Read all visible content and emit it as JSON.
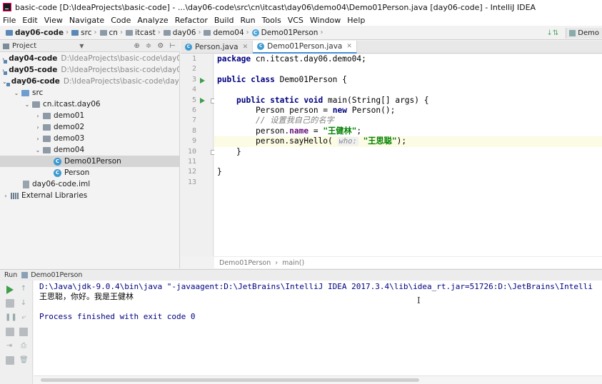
{
  "window": {
    "title": "basic-code [D:\\IdeaProjects\\basic-code] - ...\\day06-code\\src\\cn\\itcast\\day06\\demo04\\Demo01Person.java [day06-code] - IntelliJ IDEA"
  },
  "menu": [
    "File",
    "Edit",
    "View",
    "Navigate",
    "Code",
    "Analyze",
    "Refactor",
    "Build",
    "Run",
    "Tools",
    "VCS",
    "Window",
    "Help"
  ],
  "breadcrumb": [
    "day06-code",
    "src",
    "cn",
    "itcast",
    "day06",
    "demo04",
    "Demo01Person"
  ],
  "toolbar_right": {
    "run_config": "Demo"
  },
  "project_panel": {
    "title": "Project",
    "tree": [
      {
        "label": "day04-code",
        "path": "D:\\IdeaProjects\\basic-code\\day04-code",
        "arrow": "›"
      },
      {
        "label": "day05-code",
        "path": "D:\\IdeaProjects\\basic-code\\day05-code",
        "arrow": "›"
      },
      {
        "label": "day06-code",
        "path": "D:\\IdeaProjects\\basic-code\\day06-code",
        "arrow": "⌄"
      },
      {
        "label": "src",
        "arrow": "⌄"
      },
      {
        "label": "cn.itcast.day06",
        "arrow": "⌄"
      },
      {
        "label": "demo01",
        "arrow": "›"
      },
      {
        "label": "demo02",
        "arrow": "›"
      },
      {
        "label": "demo03",
        "arrow": "›"
      },
      {
        "label": "demo04",
        "arrow": "⌄"
      },
      {
        "label": "Demo01Person"
      },
      {
        "label": "Person"
      },
      {
        "label": "day06-code.iml"
      },
      {
        "label": "External Libraries",
        "arrow": "›"
      }
    ]
  },
  "tabs": [
    {
      "label": "Person.java"
    },
    {
      "label": "Demo01Person.java"
    }
  ],
  "editor": {
    "line_numbers": [
      "1",
      "2",
      "3",
      "4",
      "5",
      "6",
      "7",
      "8",
      "9",
      "10",
      "11",
      "12",
      "13"
    ],
    "code": {
      "l1_kw": "package",
      "l1_rest": " cn.itcast.day06.demo04;",
      "l3_kw1": "public",
      "l3_kw2": "class",
      "l3_rest": " Demo01Person {",
      "l5_kw1": "public",
      "l5_kw2": "static",
      "l5_kw3": "void",
      "l5_rest": " main(String[] args) {",
      "l6_a": "Person person = ",
      "l6_kw": "new",
      "l6_b": " Person();",
      "l7_comment": "// 设置我自己的名字",
      "l8_a": "person.",
      "l8_field": "name",
      "l8_b": " = ",
      "l8_str": "\"王健林\"",
      "l8_c": ";",
      "l9_a": "person.sayHello( ",
      "l9_hint": "who:",
      "l9_str": "\"王思聪\"",
      "l9_c": ");",
      "l10": "}",
      "l12": "}"
    },
    "crumbs": [
      "Demo01Person",
      "main()"
    ]
  },
  "run_panel": {
    "label": "Run",
    "config": "Demo01Person",
    "console": [
      "D:\\Java\\jdk-9.0.4\\bin\\java \"-javaagent:D:\\JetBrains\\IntelliJ IDEA 2017.3.4\\lib\\idea_rt.jar=51726:D:\\JetBrains\\Intelli",
      "王思聪，你好。我是王健林",
      "",
      "Process finished with exit code 0"
    ]
  }
}
